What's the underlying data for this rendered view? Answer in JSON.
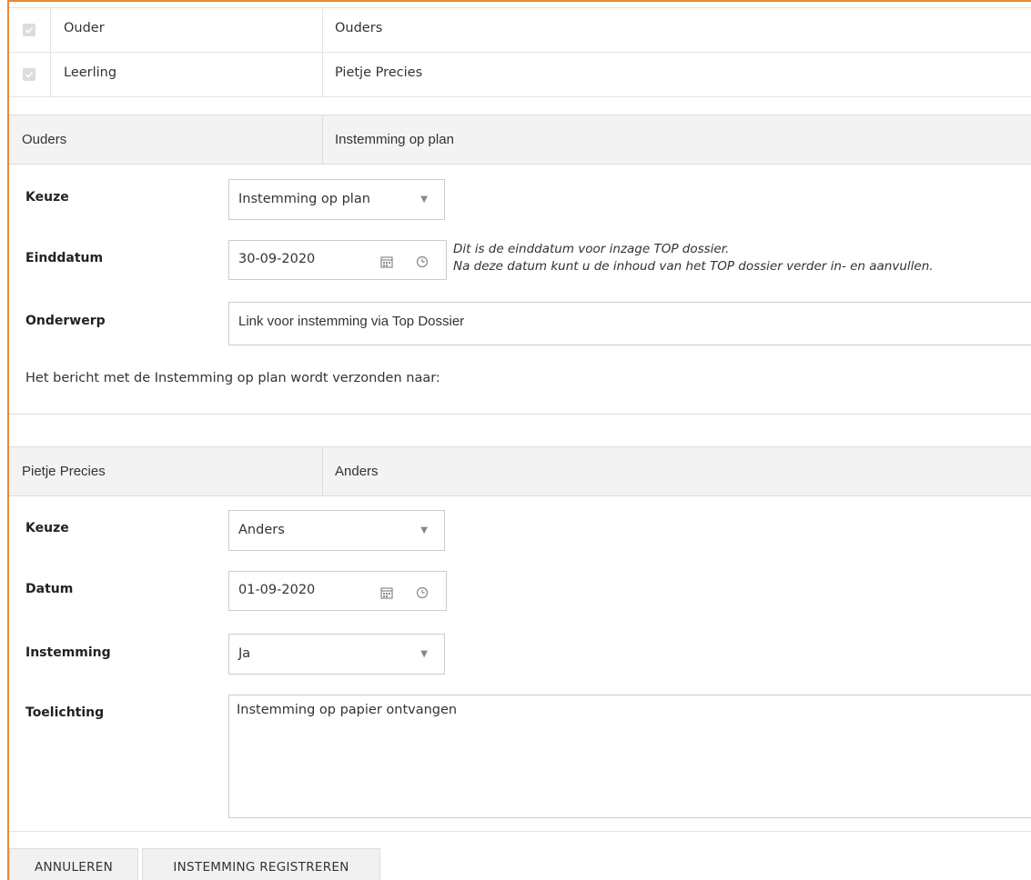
{
  "recipients": [
    {
      "role": "Ouder",
      "name": "Ouders"
    },
    {
      "role": "Leerling",
      "name": "Pietje Precies"
    }
  ],
  "section1": {
    "header_name": "Ouders",
    "header_status": "Instemming op plan",
    "keuze_label": "Keuze",
    "keuze_value": "Instemming op plan",
    "einddatum_label": "Einddatum",
    "einddatum_value": "30-09-2020",
    "einddatum_note_line1": "Dit is de einddatum voor inzage TOP dossier.",
    "einddatum_note_line2": "Na deze datum kunt u de inhoud van het TOP dossier verder in- en aanvullen.",
    "onderwerp_label": "Onderwerp",
    "onderwerp_value": "Link voor instemming via Top Dossier",
    "message_text": "Het bericht met de Instemming op plan wordt verzonden naar:"
  },
  "section2": {
    "header_name": "Pietje Precies",
    "header_status": "Anders",
    "keuze_label": "Keuze",
    "keuze_value": "Anders",
    "datum_label": "Datum",
    "datum_value": "01-09-2020",
    "instemming_label": "Instemming",
    "instemming_value": "Ja",
    "toelichting_label": "Toelichting",
    "toelichting_value": "Instemming op papier ontvangen"
  },
  "buttons": {
    "cancel": "ANNULEREN",
    "submit": "INSTEMMING REGISTREREN"
  },
  "colors": {
    "accent_border": "#e8893a"
  }
}
